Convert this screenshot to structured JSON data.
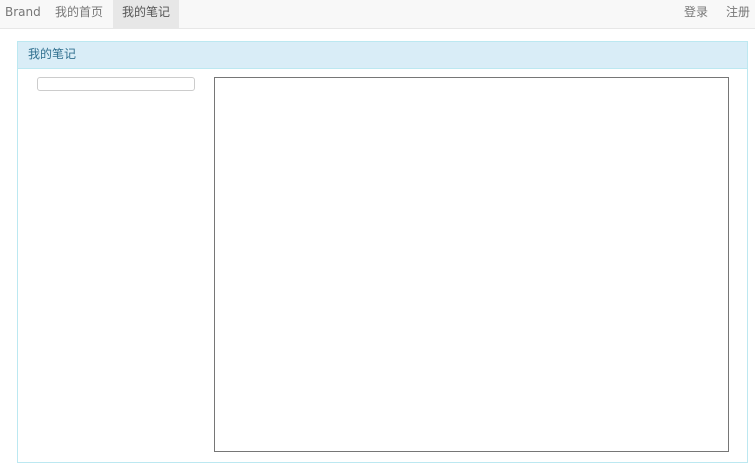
{
  "navbar": {
    "brand": "Brand",
    "items": [
      {
        "label": "我的首页",
        "active": false
      },
      {
        "label": "我的笔记",
        "active": true
      }
    ],
    "right_items": [
      {
        "label": "登录"
      },
      {
        "label": "注册"
      }
    ]
  },
  "panel": {
    "title": "我的笔记",
    "sidebar_input": {
      "value": "",
      "placeholder": ""
    },
    "editor": {
      "value": "",
      "placeholder": ""
    }
  },
  "colors": {
    "navbar_bg": "#f8f8f8",
    "nav_active_bg": "#e7e7e7",
    "panel_heading_bg": "#d9edf7",
    "panel_border": "#bce8f1",
    "panel_heading_text": "#31708f"
  }
}
